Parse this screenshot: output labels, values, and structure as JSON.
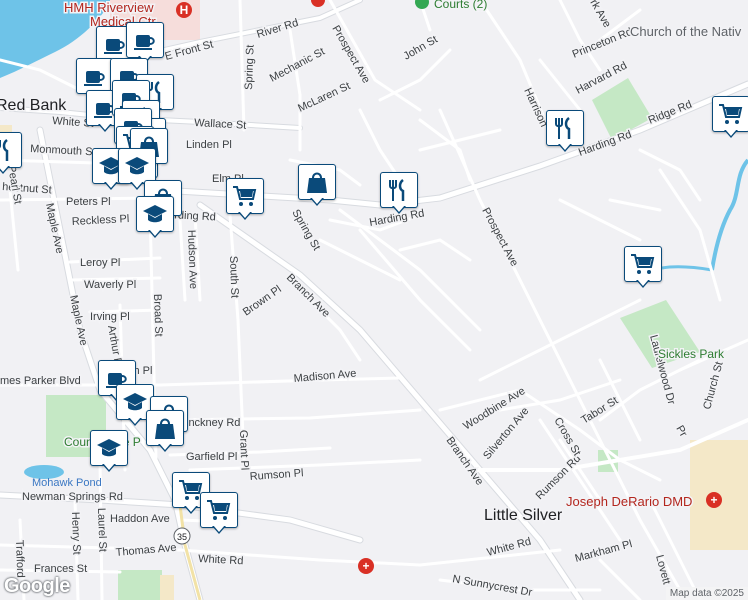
{
  "map": {
    "colors": {
      "land": "#f1f1f4",
      "water": "#6ec3e8",
      "park": "#c5e8c5",
      "road": "#ffffff",
      "road_edge": "#d8dbe0",
      "highway": "#f2e2a6",
      "marker_blue": "#0a4a7a"
    },
    "places": {
      "town_red_bank": "Red Bank",
      "town_little_silver": "Little Silver",
      "park_sickles": "Sickles Park",
      "park_count_basie": "Count Basie P",
      "pond_mohawk": "Mohawk Pond",
      "hospital_top": "HMH Riverview",
      "hospital_top_line2": "Medical Ctr",
      "courts": "Courts (2)",
      "church": "Church of the Nativ",
      "dentist": "Joseph DeRario DMD",
      "route_shield": "35"
    },
    "streets": {
      "river_rd": "River Rd",
      "e_front_st": "E Front St",
      "mechanic_st": "Mechanic St",
      "spring_st_n": "Spring St",
      "spring_st_s": "Spring St",
      "prospect_ave_n": "Prospect Ave",
      "prospect_ave_s": "Prospect Ave",
      "john_st": "John St",
      "mclaren_st": "McLaren St",
      "wallace_st": "Wallace St",
      "white_st": "White St",
      "monmouth_st": "Monmouth St",
      "linden_pl": "Linden Pl",
      "elm_pl": "Elm Pl",
      "peters_pl": "Peters Pl",
      "chestnut_st": "hestnut St",
      "reckless_pl": "Reckless Pl",
      "harding_rd_w": "arding Rd",
      "harding_rd_c": "Harding Rd",
      "harding_rd_e": "Harding Rd",
      "ridge_rd": "Ridge Rd",
      "harrison": "Harrison",
      "harvard_rd": "Harvard Rd",
      "princeton_rd": "Princeton Rd",
      "park_ave": "rk Ave",
      "pearl_st": "Pearl St",
      "maple_ave": "Maple Ave",
      "leroy_pl": "Leroy Pl",
      "waverly_pl": "Waverly Pl",
      "irving_pl": "Irving Pl",
      "broad_st": "Broad St",
      "hudson_ave": "Hudson Ave",
      "south_st": "South St",
      "brown_pl": "Brown Pl",
      "branch_ave_n": "Branch Ave",
      "branch_ave_s": "Branch Ave",
      "arthur_pl": "Arthur P",
      "ch_pl": "ch Pl",
      "james_parker_blvd": "mes Parker Blvd",
      "madison_ave": "Madison Ave",
      "pinckney_rd": "inckney Rd",
      "grant_pl": "Grant Pl",
      "garfield_pl": "Garfield Pl",
      "rumson_pl": "Rumson Pl",
      "newman_springs_rd": "Newman Springs Rd",
      "haddon_ave": "Haddon Ave",
      "henry_st": "Henry St",
      "laurel_st": "Laurel St",
      "trafford": "Trafford",
      "thomas_ave": "Thomas Ave",
      "frances_st": "Frances St",
      "white_rd_w": "White Rd",
      "white_rd_e": "White Rd",
      "n_sunnycrest_dr": "N Sunnycrest Dr",
      "markham_pl": "Markham Pl",
      "lovett": "Lovett",
      "rumson_rd": "Rumson Rd",
      "woodbine_ave": "Woodbine Ave",
      "silverton_ave": "Silverton Ave",
      "cross_st": "Cross St",
      "tabor_st": "Tabor St",
      "laurelwood_dr": "Laurelwood Dr",
      "church_st": "Church St",
      "pr": "Pr"
    },
    "markers": [
      {
        "id": "m1",
        "icon": "coffee-icon"
      },
      {
        "id": "m2",
        "icon": "coffee-icon"
      },
      {
        "id": "m3",
        "icon": "coffee-icon"
      },
      {
        "id": "m4",
        "icon": "coffee-icon"
      },
      {
        "id": "m5",
        "icon": "restaurant-icon"
      },
      {
        "id": "m6",
        "icon": "coffee-icon"
      },
      {
        "id": "m7",
        "icon": "coffee-icon"
      },
      {
        "id": "m8",
        "icon": "restaurant-icon"
      },
      {
        "id": "m9",
        "icon": "shopping-bag-icon"
      },
      {
        "id": "m10",
        "icon": "coffee-icon"
      },
      {
        "id": "m11",
        "icon": "coffee-icon"
      },
      {
        "id": "m12",
        "icon": "shopping-cart-icon"
      },
      {
        "id": "m13",
        "icon": "restaurant-icon"
      },
      {
        "id": "m14",
        "icon": "school-icon"
      },
      {
        "id": "m15",
        "icon": "shopping-bag-icon"
      },
      {
        "id": "m16",
        "icon": "school-icon"
      },
      {
        "id": "m17",
        "icon": "shopping-bag-icon"
      },
      {
        "id": "m18",
        "icon": "school-icon"
      },
      {
        "id": "m19",
        "icon": "shopping-cart-icon"
      },
      {
        "id": "m20",
        "icon": "shopping-bag-icon"
      },
      {
        "id": "m21",
        "icon": "restaurant-icon"
      },
      {
        "id": "m22",
        "icon": "shopping-cart-icon"
      },
      {
        "id": "m23",
        "icon": "restaurant-icon"
      },
      {
        "id": "m24",
        "icon": "shopping-cart-icon"
      },
      {
        "id": "m25",
        "icon": "coffee-icon"
      },
      {
        "id": "m26",
        "icon": "school-icon"
      },
      {
        "id": "m27",
        "icon": "shopping-bag-icon"
      },
      {
        "id": "m28",
        "icon": "shopping-bag-icon"
      },
      {
        "id": "m29",
        "icon": "school-icon"
      },
      {
        "id": "m30",
        "icon": "shopping-cart-icon"
      },
      {
        "id": "m31",
        "icon": "shopping-cart-icon"
      }
    ],
    "footer": {
      "logo": "Google",
      "attribution": "Map data ©2025"
    }
  }
}
